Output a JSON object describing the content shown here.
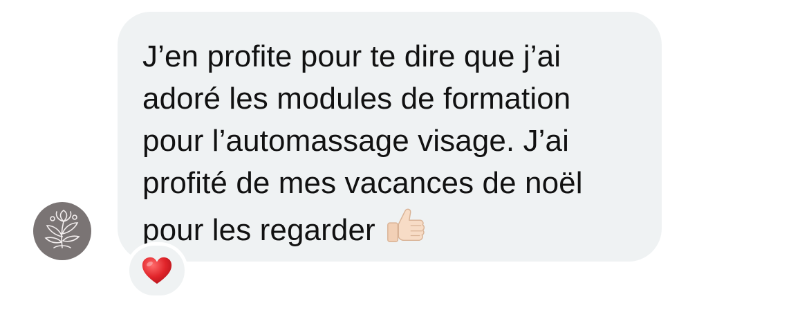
{
  "message": {
    "lines": [
      "J’en profite pour te dire que j’ai",
      "adoré les modules de formation",
      "pour l’automassage visage. J’ai",
      "profité de mes vacances de noël",
      "pour les regarder"
    ],
    "emoji": "thumbs-up-light-skin-tone"
  },
  "reaction": {
    "emoji": "red-heart"
  },
  "avatar": {
    "icon": "floral-avatar-icon"
  },
  "colors": {
    "bubble": "#eff2f3",
    "text": "#111111",
    "avatar_bg": "#7a7474",
    "heart": "#e0242a"
  }
}
